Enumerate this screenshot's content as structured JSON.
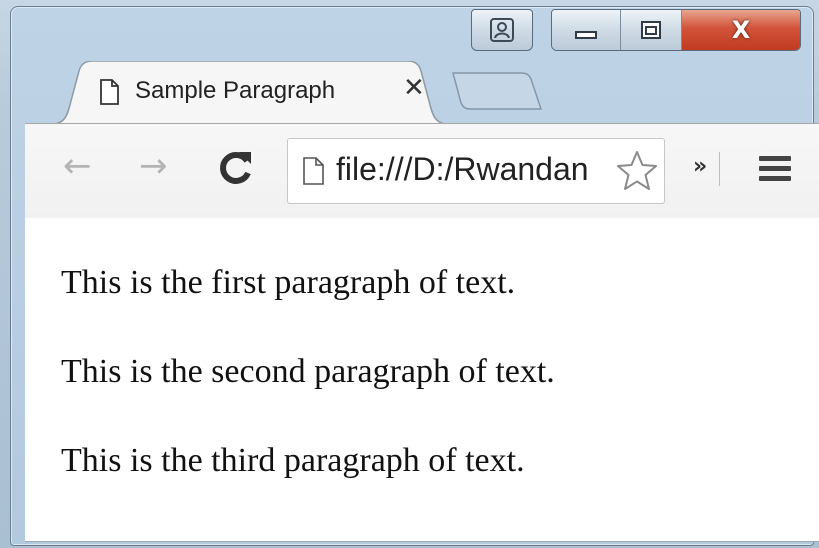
{
  "tab": {
    "title": "Sample Paragraph",
    "close_glyph": "✕"
  },
  "caption": {
    "close_glyph": "X"
  },
  "toolbar": {
    "back_glyph": "←",
    "forward_glyph": "→",
    "reload_glyph": "C",
    "url": "file:///D:/Rwandan",
    "overflow_glyph": "»"
  },
  "icons": {
    "profile": "person-icon",
    "minimize": "minimize-icon",
    "maximize": "maximize-icon",
    "close": "close-icon",
    "tab_favicon": "page-icon",
    "bookmark": "star-icon",
    "menu": "hamburger-menu-icon"
  },
  "colors": {
    "close_button": "#c13b22",
    "content_background": "#ffffff",
    "toolbar_background": "#f2f2f2"
  },
  "content": {
    "paragraphs": [
      "This is the first paragraph of text.",
      "This is the second paragraph of text.",
      "This is the third paragraph of text."
    ]
  }
}
